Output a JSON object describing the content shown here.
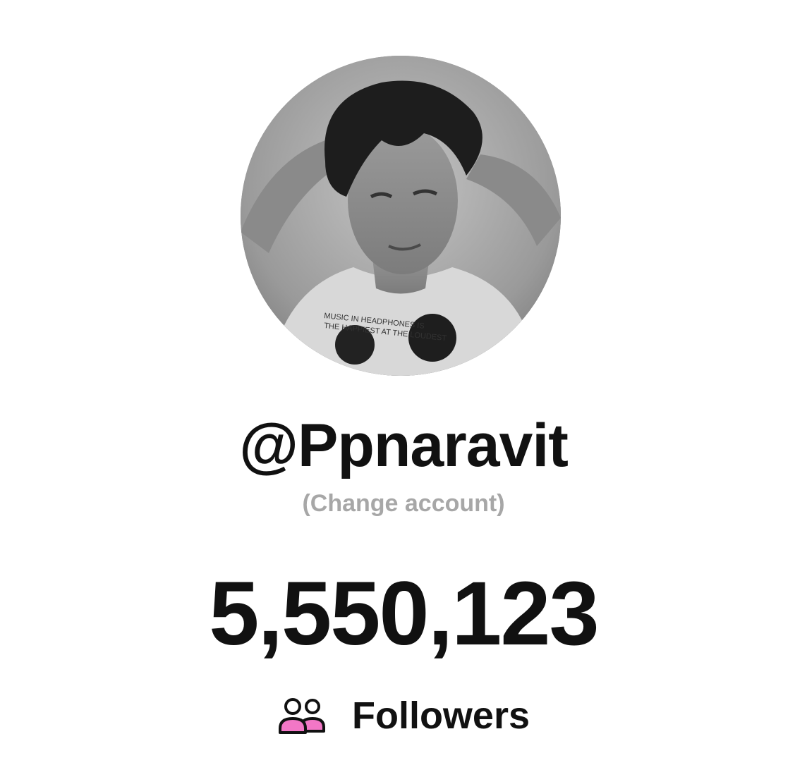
{
  "profile": {
    "username": "@Ppnaravit",
    "change_account_label": "(Change account)",
    "follower_count": "5,550,123",
    "followers_label": "Followers"
  },
  "avatar": {
    "shirt_text_line1": "MUSIC IN HEADPHONES IS",
    "shirt_text_line2": "THE HAPPIEST AT THE LOUDEST"
  },
  "icons": {
    "followers": "users-icon"
  },
  "colors": {
    "text": "#111111",
    "muted": "#a7a7a7",
    "accent_pink": "#f277c6",
    "background": "#ffffff"
  }
}
